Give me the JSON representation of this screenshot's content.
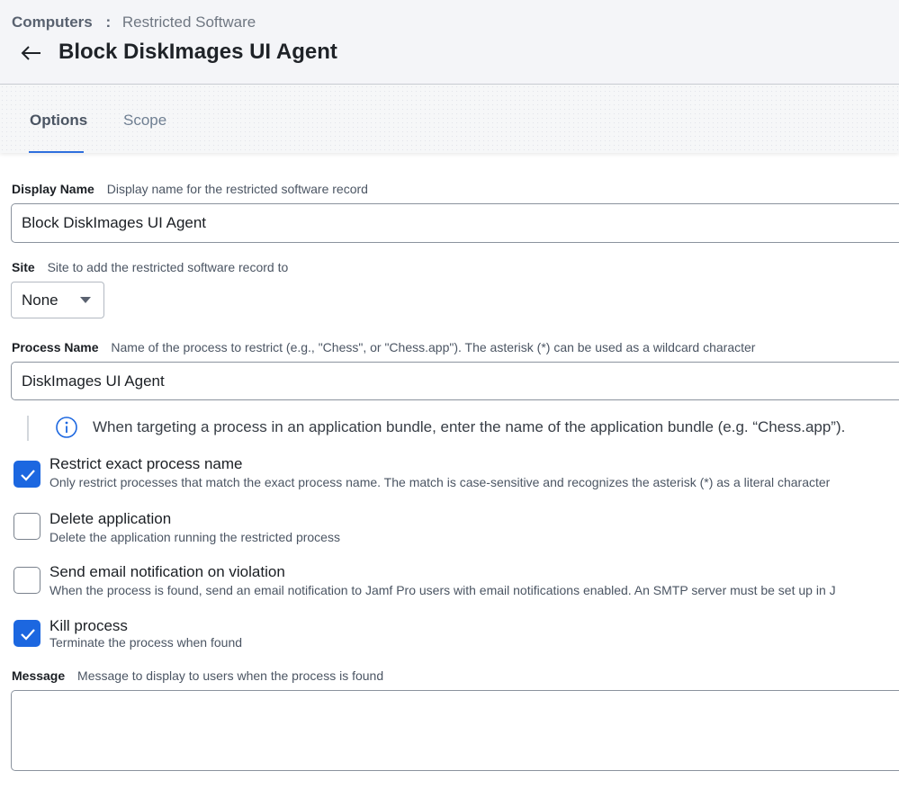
{
  "header": {
    "breadcrumb_root": "Computers",
    "breadcrumb_sep": ":",
    "breadcrumb_current": "Restricted Software",
    "title": "Block DiskImages UI Agent"
  },
  "tabs": [
    {
      "label": "Options",
      "active": true
    },
    {
      "label": "Scope",
      "active": false
    }
  ],
  "form": {
    "display_name": {
      "label": "Display Name",
      "hint": "Display name for the restricted software record",
      "value": "Block DiskImages UI Agent"
    },
    "site": {
      "label": "Site",
      "hint": "Site to add the restricted software record to",
      "value": "None"
    },
    "process_name": {
      "label": "Process Name",
      "hint": "Name of the process to restrict (e.g., \"Chess\", or \"Chess.app\"). The asterisk (*) can be used as a wildcard character",
      "value": "DiskImages UI Agent"
    },
    "info_note": "When targeting a process in an application bundle, enter the name of the application bundle (e.g. “Chess.app”).",
    "checkboxes": [
      {
        "title": "Restrict exact process name",
        "desc": "Only restrict processes that match the exact process name. The match is case-sensitive and recognizes the asterisk (*) as a literal character",
        "checked": true
      },
      {
        "title": "Delete application",
        "desc": "Delete the application running the restricted process",
        "checked": false
      },
      {
        "title": "Send email notification on violation",
        "desc": "When the process is found, send an email notification to Jamf Pro users with email notifications enabled. An SMTP server must be set up in J",
        "checked": false
      },
      {
        "title": "Kill process",
        "desc": "Terminate the process when found",
        "checked": true
      }
    ],
    "message": {
      "label": "Message",
      "hint": "Message to display to users when the process is found",
      "value": ""
    }
  },
  "colors": {
    "accent": "#1c67e0",
    "tab_underline": "#2f6fdd",
    "header_bg": "#f4f5f8"
  },
  "icons": {
    "back": "arrow-left-icon",
    "info": "info-circle-icon",
    "check": "checkmark-icon",
    "select_caret": "caret-down-icon"
  }
}
